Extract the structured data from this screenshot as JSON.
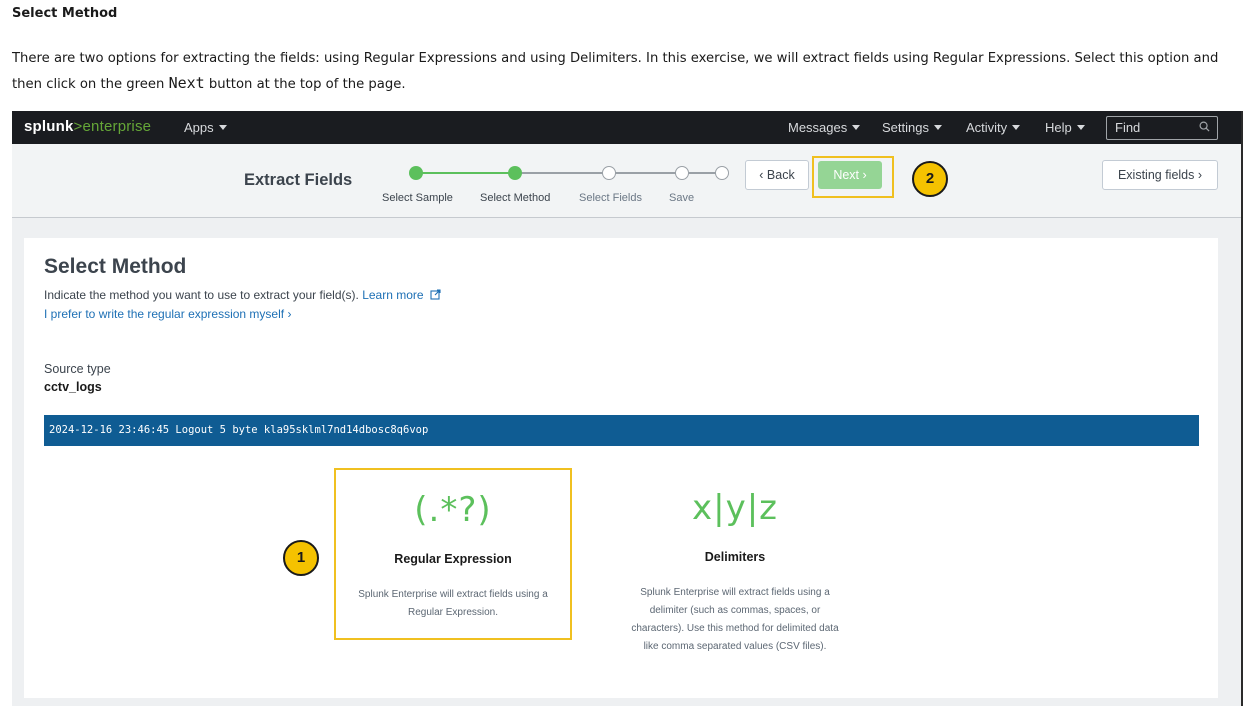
{
  "doc": {
    "heading": "Select Method",
    "para_part1": "There are two options for extracting the fields: using Regular Expressions and using Delimiters. In this exercise, we will extract fields using Regular Expressions. Select this option and then click on the green ",
    "para_code": "Next",
    "para_part2": " button at the top of the page."
  },
  "topnav": {
    "logo_brand": "splunk",
    "logo_rest": ">enterprise",
    "apps": "Apps",
    "messages": "Messages",
    "settings": "Settings",
    "activity": "Activity",
    "help": "Help",
    "find_placeholder": "Find"
  },
  "wizard": {
    "title": "Extract Fields",
    "steps": [
      "Select Sample",
      "Select Method",
      "Select Fields",
      "Save"
    ],
    "back_label": "Back",
    "next_label": "Next",
    "existing_label": "Existing fields",
    "accent_color": "#5cc05c"
  },
  "callouts": {
    "one": "1",
    "two": "2"
  },
  "panel": {
    "title": "Select Method",
    "desc": "Indicate the method you want to use to extract your field(s).",
    "learn_more": "Learn more",
    "prefer_link": "I prefer to write the regular expression myself",
    "source_type_label": "Source type",
    "source_type_value": "cctv_logs",
    "sample_event": "2024-12-16 23:46:45 Logout 5 byte kla95sklml7nd14dbosc8q6vop"
  },
  "methods": [
    {
      "glyph": "(.*?)",
      "name": "Regular Expression",
      "desc": "Splunk Enterprise will extract fields using a Regular Expression."
    },
    {
      "glyph": "x|y|z",
      "name": "Delimiters",
      "desc": "Splunk Enterprise will extract fields using a delimiter (such as commas, spaces, or characters). Use this method for delimited data like comma separated values (CSV files)."
    }
  ]
}
